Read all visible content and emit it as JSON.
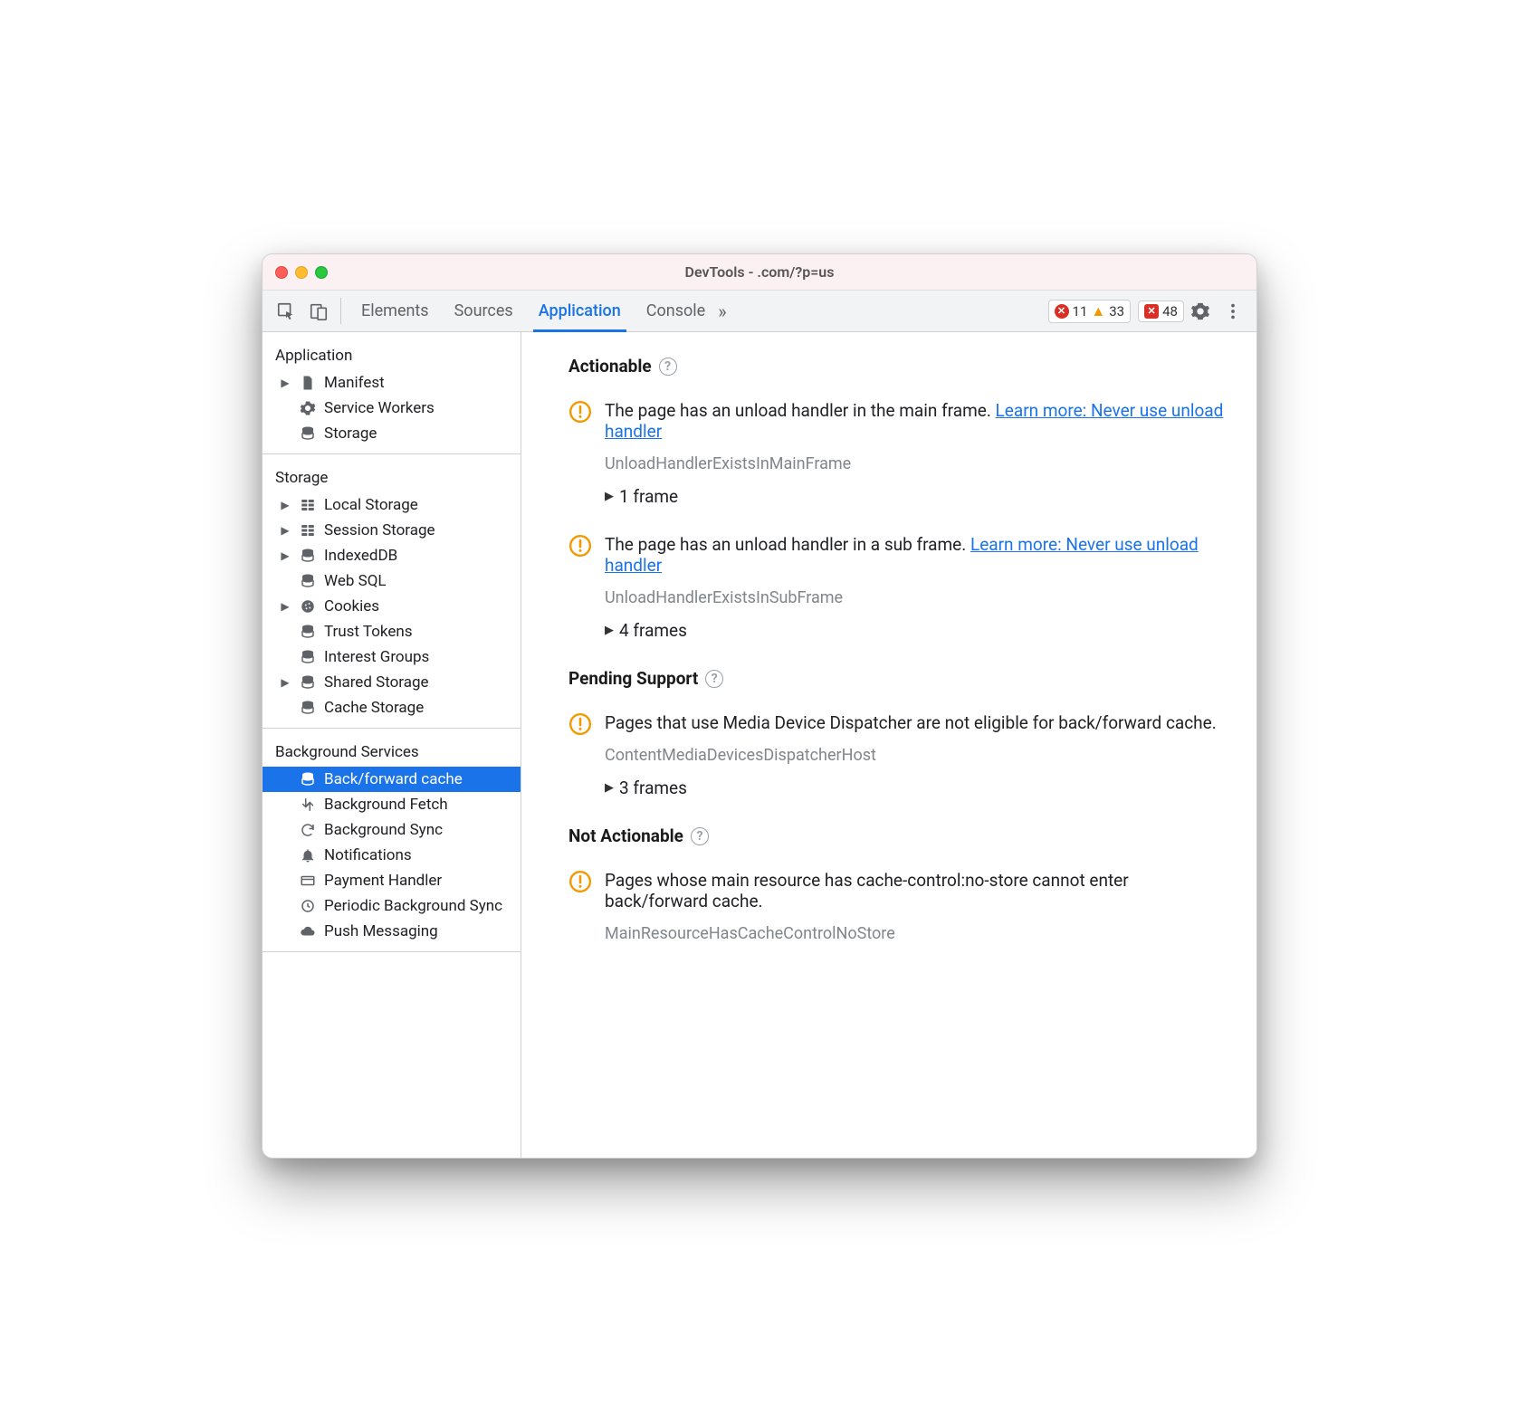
{
  "window": {
    "title": "DevTools -           .com/?p=us"
  },
  "tabbar": {
    "tabs": [
      "Elements",
      "Sources",
      "Application",
      "Console"
    ],
    "active_index": 2,
    "more_glyph": "»",
    "errors_count": "11",
    "warnings_count": "33",
    "issues_count": "48"
  },
  "sidebar": {
    "sections": [
      {
        "heading": "Application",
        "items": [
          {
            "label": "Manifest",
            "icon": "file-icon",
            "expandable": true
          },
          {
            "label": "Service Workers",
            "icon": "gear-icon",
            "expandable": false
          },
          {
            "label": "Storage",
            "icon": "storage-icon",
            "expandable": false
          }
        ]
      },
      {
        "heading": "Storage",
        "items": [
          {
            "label": "Local Storage",
            "icon": "grid-icon",
            "expandable": true
          },
          {
            "label": "Session Storage",
            "icon": "grid-icon",
            "expandable": true
          },
          {
            "label": "IndexedDB",
            "icon": "storage-icon",
            "expandable": true
          },
          {
            "label": "Web SQL",
            "icon": "storage-icon",
            "expandable": false
          },
          {
            "label": "Cookies",
            "icon": "cookie-icon",
            "expandable": true
          },
          {
            "label": "Trust Tokens",
            "icon": "storage-icon",
            "expandable": false
          },
          {
            "label": "Interest Groups",
            "icon": "storage-icon",
            "expandable": false
          },
          {
            "label": "Shared Storage",
            "icon": "storage-icon",
            "expandable": true
          },
          {
            "label": "Cache Storage",
            "icon": "storage-icon",
            "expandable": false
          }
        ]
      },
      {
        "heading": "Background Services",
        "items": [
          {
            "label": "Back/forward cache",
            "icon": "storage-icon",
            "expandable": false,
            "selected": true
          },
          {
            "label": "Background Fetch",
            "icon": "fetch-icon",
            "expandable": false
          },
          {
            "label": "Background Sync",
            "icon": "sync-icon",
            "expandable": false
          },
          {
            "label": "Notifications",
            "icon": "bell-icon",
            "expandable": false
          },
          {
            "label": "Payment Handler",
            "icon": "card-icon",
            "expandable": false
          },
          {
            "label": "Periodic Background Sync",
            "icon": "clock-icon",
            "expandable": false
          },
          {
            "label": "Push Messaging",
            "icon": "cloud-icon",
            "expandable": false
          }
        ]
      }
    ]
  },
  "main": {
    "sections": [
      {
        "title": "Actionable",
        "issues": [
          {
            "text": "The page has an unload handler in the main frame. ",
            "link": "Learn more: Never use unload handler",
            "code": "UnloadHandlerExistsInMainFrame",
            "frames": "1 frame"
          },
          {
            "text": "The page has an unload handler in a sub frame. ",
            "link": "Learn more: Never use unload handler",
            "code": "UnloadHandlerExistsInSubFrame",
            "frames": "4 frames"
          }
        ]
      },
      {
        "title": "Pending Support",
        "issues": [
          {
            "text": "Pages that use Media Device Dispatcher are not eligible for back/forward cache.",
            "link": "",
            "code": "ContentMediaDevicesDispatcherHost",
            "frames": "3 frames"
          }
        ]
      },
      {
        "title": "Not Actionable",
        "issues": [
          {
            "text": "Pages whose main resource has cache-control:no-store cannot enter back/forward cache.",
            "link": "",
            "code": "MainResourceHasCacheControlNoStore",
            "frames": ""
          }
        ]
      }
    ]
  }
}
